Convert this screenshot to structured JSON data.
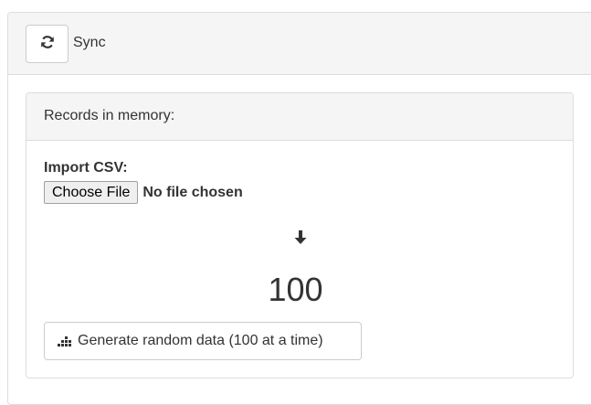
{
  "toolbar": {
    "sync_icon": "refresh-icon",
    "sync_label": "Sync"
  },
  "panel": {
    "heading": "Records in memory:",
    "import_label": "Import CSV:",
    "choose_file_label": "Choose File",
    "file_status": "No file chosen",
    "arrow_icon": "arrow-down-icon",
    "record_count": "100",
    "generate_icon": "bar-chart-icon",
    "generate_label": "Generate random data (100 at a time)"
  }
}
